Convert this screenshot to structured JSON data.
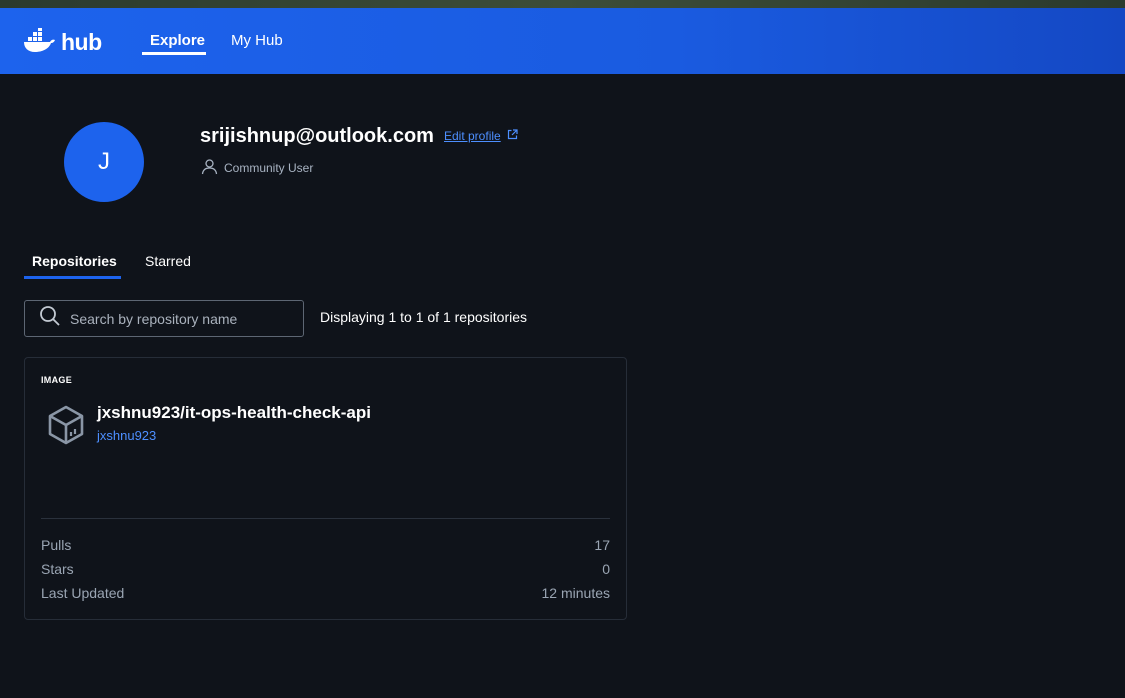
{
  "header": {
    "logo_text": "hub",
    "nav": [
      {
        "label": "Explore",
        "active": true
      },
      {
        "label": "My Hub",
        "active": false
      }
    ],
    "logo_color": "#ffffff",
    "background": "#1d63ed"
  },
  "profile": {
    "avatar_initial": "J",
    "avatar_color": "#1d63ed",
    "username": "srijishnup@outlook.com",
    "edit_profile_label": "Edit profile",
    "role": "Community User"
  },
  "tabs": [
    {
      "label": "Repositories",
      "active": true
    },
    {
      "label": "Starred",
      "active": false
    }
  ],
  "search": {
    "placeholder": "Search by repository name",
    "value": ""
  },
  "display_count": "Displaying 1 to 1 of 1 repositories",
  "repositories": [
    {
      "type": "IMAGE",
      "name": "jxshnu923/it-ops-health-check-api",
      "owner": "jxshnu923",
      "stats": [
        {
          "label": "Pulls",
          "value": "17"
        },
        {
          "label": "Stars",
          "value": "0"
        },
        {
          "label": "Last Updated",
          "value": "12 minutes"
        }
      ]
    }
  ],
  "colors": {
    "accent": "#1d63ed",
    "link": "#4d8fff",
    "background": "#0f131a"
  }
}
